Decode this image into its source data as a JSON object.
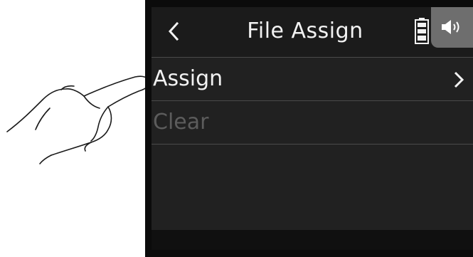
{
  "header": {
    "title": "File Assign",
    "back_icon": "chevron-left-icon",
    "battery_icon": "battery-icon",
    "speaker_icon": "speaker-icon"
  },
  "menu": {
    "items": [
      {
        "label": "Assign",
        "enabled": true,
        "icon": "chevron-right-icon"
      },
      {
        "label": "Clear",
        "enabled": false
      }
    ]
  },
  "colors": {
    "screen_bg": "#212121",
    "text": "#f2f2f2",
    "disabled_text": "#5c5c5c",
    "divider": "#4a4a4a",
    "speaker_button": "#6e6e6e"
  },
  "illustration": "hand-pointer"
}
